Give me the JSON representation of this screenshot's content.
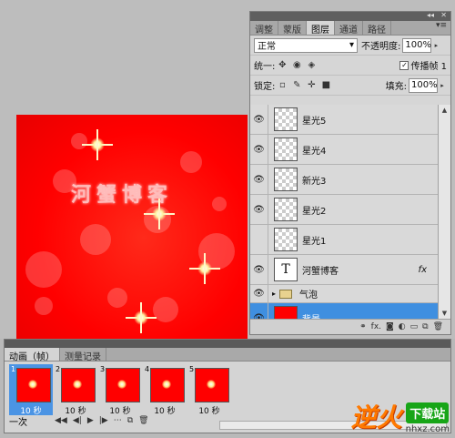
{
  "layers_panel": {
    "tabs": [
      "调整",
      "蒙版",
      "图层",
      "通道",
      "路径"
    ],
    "active_tab": "图层",
    "blend_mode": "正常",
    "opacity_label": "不透明度:",
    "opacity_value": "100%",
    "unify_label": "统一:",
    "propagate_label": "传播帧 1",
    "lock_label": "锁定:",
    "fill_label": "填充:",
    "fill_value": "100%",
    "layers": [
      {
        "name": "星光5",
        "visible": true,
        "thumb": "transparent"
      },
      {
        "name": "星光4",
        "visible": true,
        "thumb": "transparent"
      },
      {
        "name": "新光3",
        "visible": true,
        "thumb": "transparent"
      },
      {
        "name": "星光2",
        "visible": true,
        "thumb": "transparent"
      },
      {
        "name": "星光1",
        "visible": false,
        "thumb": "transparent"
      },
      {
        "name": "河蟹博客",
        "visible": true,
        "thumb": "text",
        "thumb_letter": "T",
        "effects": "fx"
      },
      {
        "name": "气泡",
        "visible": true,
        "thumb": "folder",
        "group": true
      },
      {
        "name": "背景",
        "visible": true,
        "thumb": "red",
        "selected": true
      }
    ],
    "footer_icons": [
      "link-icon",
      "fx-icon",
      "mask-icon",
      "adjustment-icon",
      "folder-icon",
      "new-layer-icon",
      "trash-icon"
    ]
  },
  "animation_panel": {
    "tabs": [
      "动画（帧）",
      "测量记录"
    ],
    "active_tab": "动画（帧）",
    "frames": [
      {
        "num": "1",
        "delay": "10 秒",
        "selected": true
      },
      {
        "num": "2",
        "delay": "10 秒",
        "selected": false
      },
      {
        "num": "3",
        "delay": "10 秒",
        "selected": false
      },
      {
        "num": "4",
        "delay": "10 秒",
        "selected": false
      },
      {
        "num": "5",
        "delay": "10 秒",
        "selected": false
      }
    ],
    "loop": "一次"
  },
  "canvas": {
    "text": "河蟹博客"
  },
  "watermark": {
    "logo": "逆火",
    "download": "下载站",
    "url": "nhxz.com"
  }
}
